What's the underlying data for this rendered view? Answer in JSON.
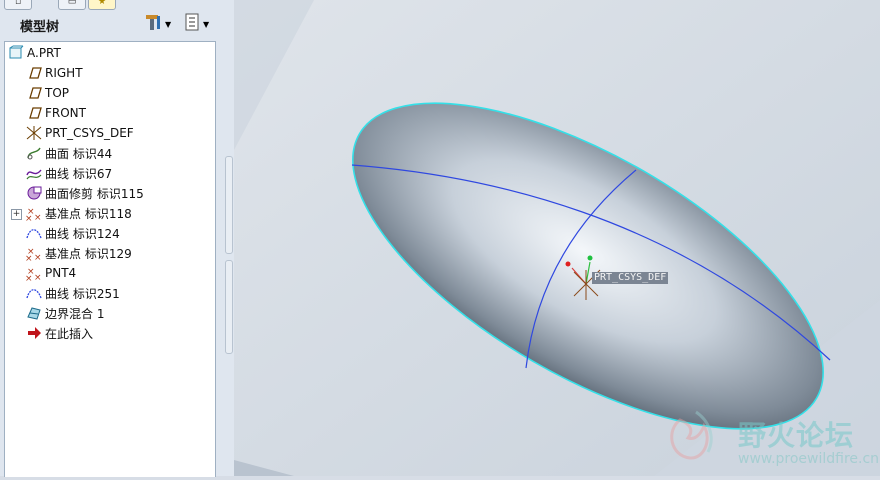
{
  "panel": {
    "title": "模型树",
    "tabs": [
      "",
      "",
      ""
    ]
  },
  "tree": {
    "items": [
      {
        "label": "A.PRT",
        "icon": "part-icon"
      },
      {
        "label": "RIGHT",
        "icon": "datum-plane-icon"
      },
      {
        "label": "TOP",
        "icon": "datum-plane-icon"
      },
      {
        "label": "FRONT",
        "icon": "datum-plane-icon"
      },
      {
        "label": "PRT_CSYS_DEF",
        "icon": "csys-icon"
      },
      {
        "label": "曲面 标识44",
        "icon": "surface-icon"
      },
      {
        "label": "曲线 标识67",
        "icon": "curve-icon"
      },
      {
        "label": "曲面修剪 标识115",
        "icon": "surface-trim-icon"
      },
      {
        "label": "基准点 标识118",
        "icon": "datum-point-icon"
      },
      {
        "label": "曲线 标识124",
        "icon": "curve-through-points-icon"
      },
      {
        "label": "基准点 标识129",
        "icon": "datum-point-icon"
      },
      {
        "label": "PNT4",
        "icon": "datum-point-icon"
      },
      {
        "label": "曲线 标识251",
        "icon": "curve-through-points-icon"
      },
      {
        "label": "边界混合 1",
        "icon": "boundary-blend-icon"
      },
      {
        "label": "在此插入",
        "icon": "insert-here-arrow-icon"
      }
    ],
    "expand_symbol": "+"
  },
  "viewport": {
    "csys_label": "PRT_CSYS_DEF",
    "watermark_text": "野火论坛",
    "watermark_url": "www.proewildfire.cn"
  },
  "colors": {
    "panel_bg": "#dfe6ef",
    "viewport_bg": "#d7dde6",
    "edge_highlight": "#34e0e8",
    "curve": "#2f48e0",
    "insert_arrow": "#c0141b"
  }
}
